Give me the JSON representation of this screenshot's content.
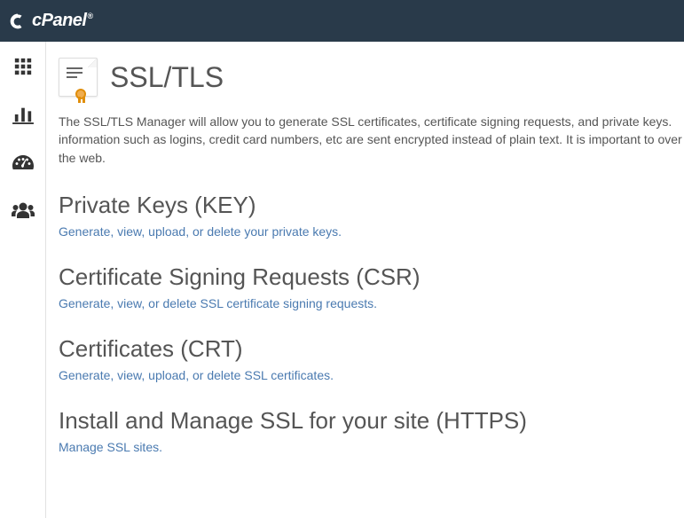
{
  "header": {
    "brand": "cPanel"
  },
  "page": {
    "title": "SSL/TLS",
    "description": "The SSL/TLS Manager will allow you to generate SSL certificates, certificate signing requests, and private keys. information such as logins, credit card numbers, etc are sent encrypted instead of plain text. It is important to over the web."
  },
  "sections": [
    {
      "title": "Private Keys (KEY)",
      "link": "Generate, view, upload, or delete your private keys."
    },
    {
      "title": "Certificate Signing Requests (CSR)",
      "link": "Generate, view, or delete SSL certificate signing requests."
    },
    {
      "title": "Certificates (CRT)",
      "link": "Generate, view, upload, or delete SSL certificates."
    },
    {
      "title": "Install and Manage SSL for your site (HTTPS)",
      "link": "Manage SSL sites."
    }
  ]
}
